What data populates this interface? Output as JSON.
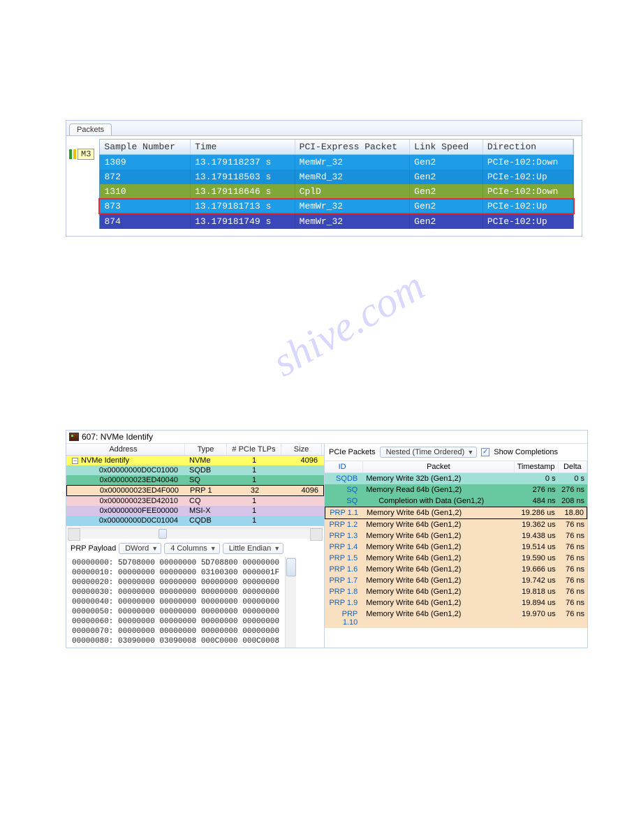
{
  "watermark": "shive.com",
  "top": {
    "tab": "Packets",
    "m3": "M3",
    "headers": [
      "Sample Number",
      "Time",
      "PCI-Express Packet",
      "Link Speed",
      "Direction"
    ],
    "rows": [
      {
        "sn": "1309",
        "time": "13.179118237 s",
        "pkt": "MemWr_32",
        "speed": "Gen2",
        "dir": "PCIe-102:Down",
        "cls": "row-blue"
      },
      {
        "sn": "872",
        "time": "13.179118503 s",
        "pkt": "MemRd_32",
        "speed": "Gen2",
        "dir": "PCIe-102:Up",
        "cls": "row-blue-dk"
      },
      {
        "sn": "1310",
        "time": "13.179118646 s",
        "pkt": "CplD",
        "speed": "Gen2",
        "dir": "PCIe-102:Down",
        "cls": "row-green"
      },
      {
        "sn": "873",
        "time": "13.179181713 s",
        "pkt": "MemWr_32",
        "speed": "Gen2",
        "dir": "PCIe-102:Up",
        "cls": "row-blue selected-red"
      },
      {
        "sn": "874",
        "time": "13.179181749 s",
        "pkt": "MemWr_32",
        "speed": "Gen2",
        "dir": "PCIe-102:Up",
        "cls": "row-purple"
      }
    ]
  },
  "bottom": {
    "title": "607: NVMe Identify",
    "addr": {
      "headers": [
        "Address",
        "Type",
        "# PCIe TLPs",
        "Size"
      ],
      "rows": [
        {
          "addr": "NVMe Identify",
          "type": "NVMe",
          "tlps": "1",
          "size": "4096",
          "cls": "bg-yellow",
          "tree": true
        },
        {
          "addr": "0x00000000D0C01000",
          "type": "SQDB",
          "tlps": "1",
          "size": "",
          "cls": "bg-teal"
        },
        {
          "addr": "0x000000023ED40040",
          "type": "SQ",
          "tlps": "1",
          "size": "",
          "cls": "bg-green2"
        },
        {
          "addr": "0x000000023ED4F000",
          "type": "PRP 1",
          "tlps": "32",
          "size": "4096",
          "cls": "bg-bisque",
          "sel": true
        },
        {
          "addr": "0x000000023ED42010",
          "type": "CQ",
          "tlps": "1",
          "size": "",
          "cls": "bg-pink"
        },
        {
          "addr": "0x00000000FEE00000",
          "type": "MSI-X",
          "tlps": "1",
          "size": "",
          "cls": "bg-purple2"
        },
        {
          "addr": "0x00000000D0C01004",
          "type": "CQDB",
          "tlps": "1",
          "size": "",
          "cls": "bg-cyan2"
        }
      ]
    },
    "payload": {
      "label": "PRP Payload",
      "combo1": "DWord",
      "combo2": "4 Columns",
      "combo3": "Little Endian",
      "hex": "00000000: 5D708000 00000000 5D708800 00000000\n00000010: 00000000 00000000 03100300 0000001F\n00000020: 00000000 00000000 00000000 00000000\n00000030: 00000000 00000000 00000000 00000000\n00000040: 00000000 00000000 00000000 00000000\n00000050: 00000000 00000000 00000000 00000000\n00000060: 00000000 00000000 00000000 00000000\n00000070: 00000000 00000000 00000000 00000000\n00000080: 03090000 03090008 000C0000 000C0008"
    },
    "right": {
      "label": "PCIe Packets",
      "combo": "Nested (Time Ordered)",
      "checkbox_label": "Show Completions",
      "headers": [
        "ID",
        "Packet",
        "Timestamp",
        "Delta"
      ],
      "rows": [
        {
          "id": "SQDB",
          "pkt": "Memory Write 32b (Gen1,2)",
          "ts": "0 s",
          "dt": "0 s",
          "cls": "bg-teal",
          "indent": 0
        },
        {
          "id": "SQ",
          "pkt": "Memory Read 64b (Gen1,2)",
          "ts": "276 ns",
          "dt": "276 ns",
          "cls": "bg-green2",
          "indent": 0
        },
        {
          "id": "SQ",
          "pkt": "Completion with Data (Gen1,2)",
          "ts": "484 ns",
          "dt": "208 ns",
          "cls": "bg-green2",
          "indent": 1
        },
        {
          "id": "PRP 1.1",
          "pkt": "Memory Write 64b (Gen1,2)",
          "ts": "19.286 us",
          "dt": "18.80",
          "cls": "bg-bisque",
          "indent": 0,
          "sel": true
        },
        {
          "id": "PRP 1.2",
          "pkt": "Memory Write 64b (Gen1,2)",
          "ts": "19.362 us",
          "dt": "76 ns",
          "cls": "bg-bisque",
          "indent": 0
        },
        {
          "id": "PRP 1.3",
          "pkt": "Memory Write 64b (Gen1,2)",
          "ts": "19.438 us",
          "dt": "76 ns",
          "cls": "bg-bisque",
          "indent": 0
        },
        {
          "id": "PRP 1.4",
          "pkt": "Memory Write 64b (Gen1,2)",
          "ts": "19.514 us",
          "dt": "76 ns",
          "cls": "bg-bisque",
          "indent": 0
        },
        {
          "id": "PRP 1.5",
          "pkt": "Memory Write 64b (Gen1,2)",
          "ts": "19.590 us",
          "dt": "76 ns",
          "cls": "bg-bisque",
          "indent": 0
        },
        {
          "id": "PRP 1.6",
          "pkt": "Memory Write 64b (Gen1,2)",
          "ts": "19.666 us",
          "dt": "76 ns",
          "cls": "bg-bisque",
          "indent": 0
        },
        {
          "id": "PRP 1.7",
          "pkt": "Memory Write 64b (Gen1,2)",
          "ts": "19.742 us",
          "dt": "76 ns",
          "cls": "bg-bisque",
          "indent": 0
        },
        {
          "id": "PRP 1.8",
          "pkt": "Memory Write 64b (Gen1,2)",
          "ts": "19.818 us",
          "dt": "76 ns",
          "cls": "bg-bisque",
          "indent": 0
        },
        {
          "id": "PRP 1.9",
          "pkt": "Memory Write 64b (Gen1,2)",
          "ts": "19.894 us",
          "dt": "76 ns",
          "cls": "bg-bisque",
          "indent": 0
        },
        {
          "id": "PRP 1.10",
          "pkt": "Memory Write 64b (Gen1,2)",
          "ts": "19.970 us",
          "dt": "76 ns",
          "cls": "bg-bisque",
          "indent": 0
        }
      ]
    }
  }
}
